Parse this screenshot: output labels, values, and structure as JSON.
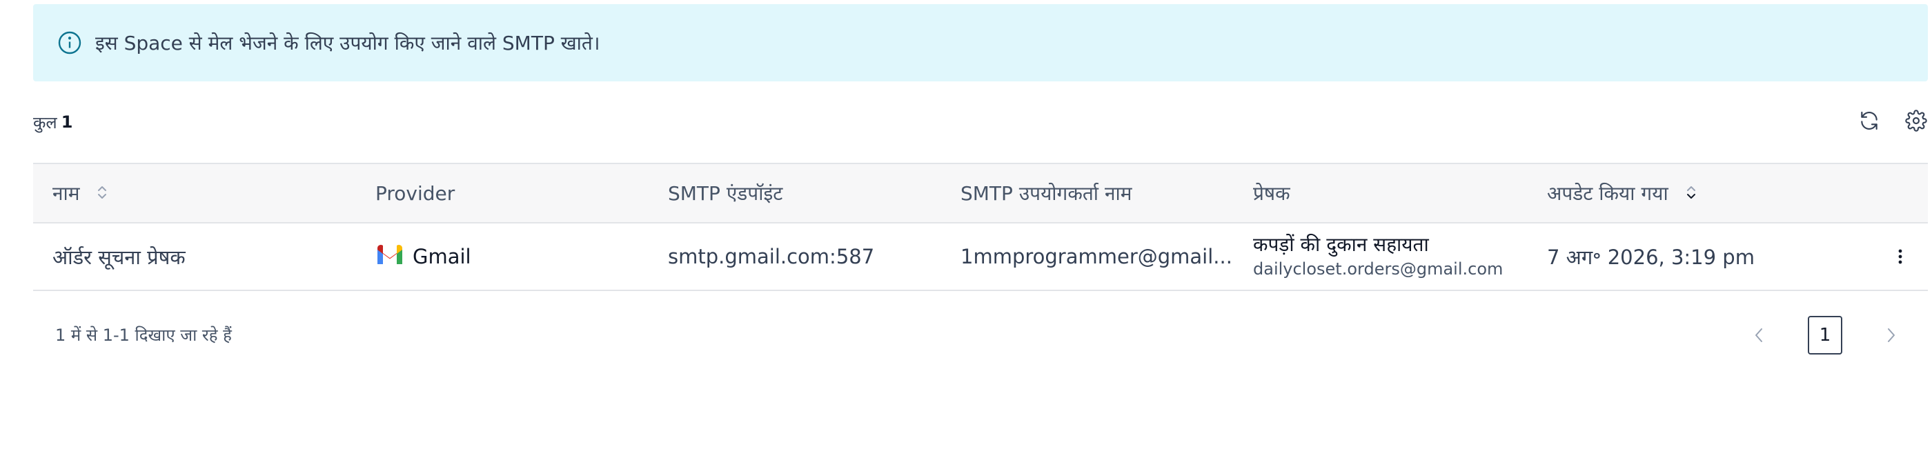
{
  "banner": {
    "text": "इस Space से मेल भेजने के लिए उपयोग किए जाने वाले SMTP खाते।",
    "icon": "info-icon"
  },
  "summary": {
    "total_label": "कुल",
    "total_count": "1",
    "refresh_icon": "refresh-icon",
    "settings_icon": "gear-icon"
  },
  "table": {
    "columns": {
      "name": "नाम",
      "provider": "Provider",
      "endpoint": "SMTP एंडपॉइंट",
      "username": "SMTP उपयोगकर्ता नाम",
      "sender": "प्रेषक",
      "updated": "अपडेट किया गया"
    },
    "rows": [
      {
        "name": "ऑर्डर सूचना प्रेषक",
        "provider": "Gmail",
        "endpoint": "smtp.gmail.com:587",
        "username": "1mmprogrammer@gmail...",
        "sender_name": "कपड़ों की दुकान सहायता",
        "sender_email": "dailycloset.orders@gmail.com",
        "updated": "7 अग॰ 2026, 3:19 pm"
      }
    ]
  },
  "footer": {
    "range_text": "1 में से 1-1 दिखाए जा रहे हैं",
    "current_page": "1"
  },
  "colors": {
    "banner_bg": "#e0f7fc",
    "info_icon": "#0e7490",
    "header_bg": "#f7f7f8"
  }
}
